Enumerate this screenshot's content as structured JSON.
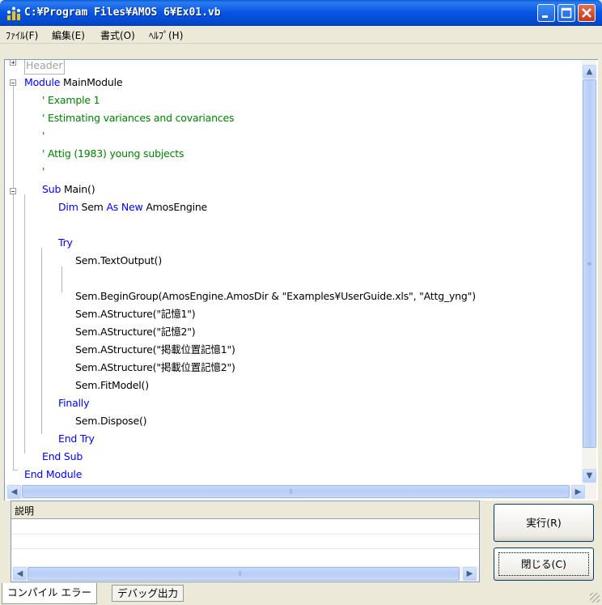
{
  "window": {
    "title": "C:¥Program Files¥AMOS 6¥Ex01.vb",
    "icon": "amos-app-icon"
  },
  "menu": {
    "items": [
      "ﾌｧｲﾙ(F)",
      "編集(E)",
      "書式(O)",
      "ﾍﾙﾌﾟ(H)"
    ]
  },
  "editor": {
    "header_label": "Header",
    "lines": {
      "l1a": "Module",
      "l1b": " MainModule",
      "l2": "' Example 1",
      "l3": "' Estimating variances and covariances",
      "l4": "'",
      "l5": "' Attig (1983) young subjects",
      "l6": "'",
      "l7a": "Sub",
      "l7b": " Main()",
      "l8a": "Dim",
      "l8b": " Sem ",
      "l8c": "As New",
      "l8d": " AmosEngine",
      "l9": "Try",
      "l10": "Sem.TextOutput()",
      "l11": "Sem.BeginGroup(AmosEngine.AmosDir & \"Examples¥UserGuide.xls\", \"Attg_yng\")",
      "l12": "Sem.AStructure(\"記憶1\")",
      "l13": "Sem.AStructure(\"記憶2\")",
      "l14": "Sem.AStructure(\"掲載位置記憶1\")",
      "l15": "Sem.AStructure(\"掲載位置記憶2\")",
      "l16": "Sem.FitModel()",
      "l17": "Finally",
      "l18": "Sem.Dispose()",
      "l19": "End Try",
      "l20": "End Sub",
      "l21": "End Module"
    }
  },
  "description": {
    "label": "説明"
  },
  "buttons": {
    "run": "実行(R)",
    "close": "閉じる(C)"
  },
  "tabs": {
    "compile_errors": "コンパイル エラー",
    "debug_output": "デバッグ出力"
  },
  "colors": {
    "keyword": "#0000ff",
    "comment": "#008000",
    "titlebar": "#0554e3"
  }
}
